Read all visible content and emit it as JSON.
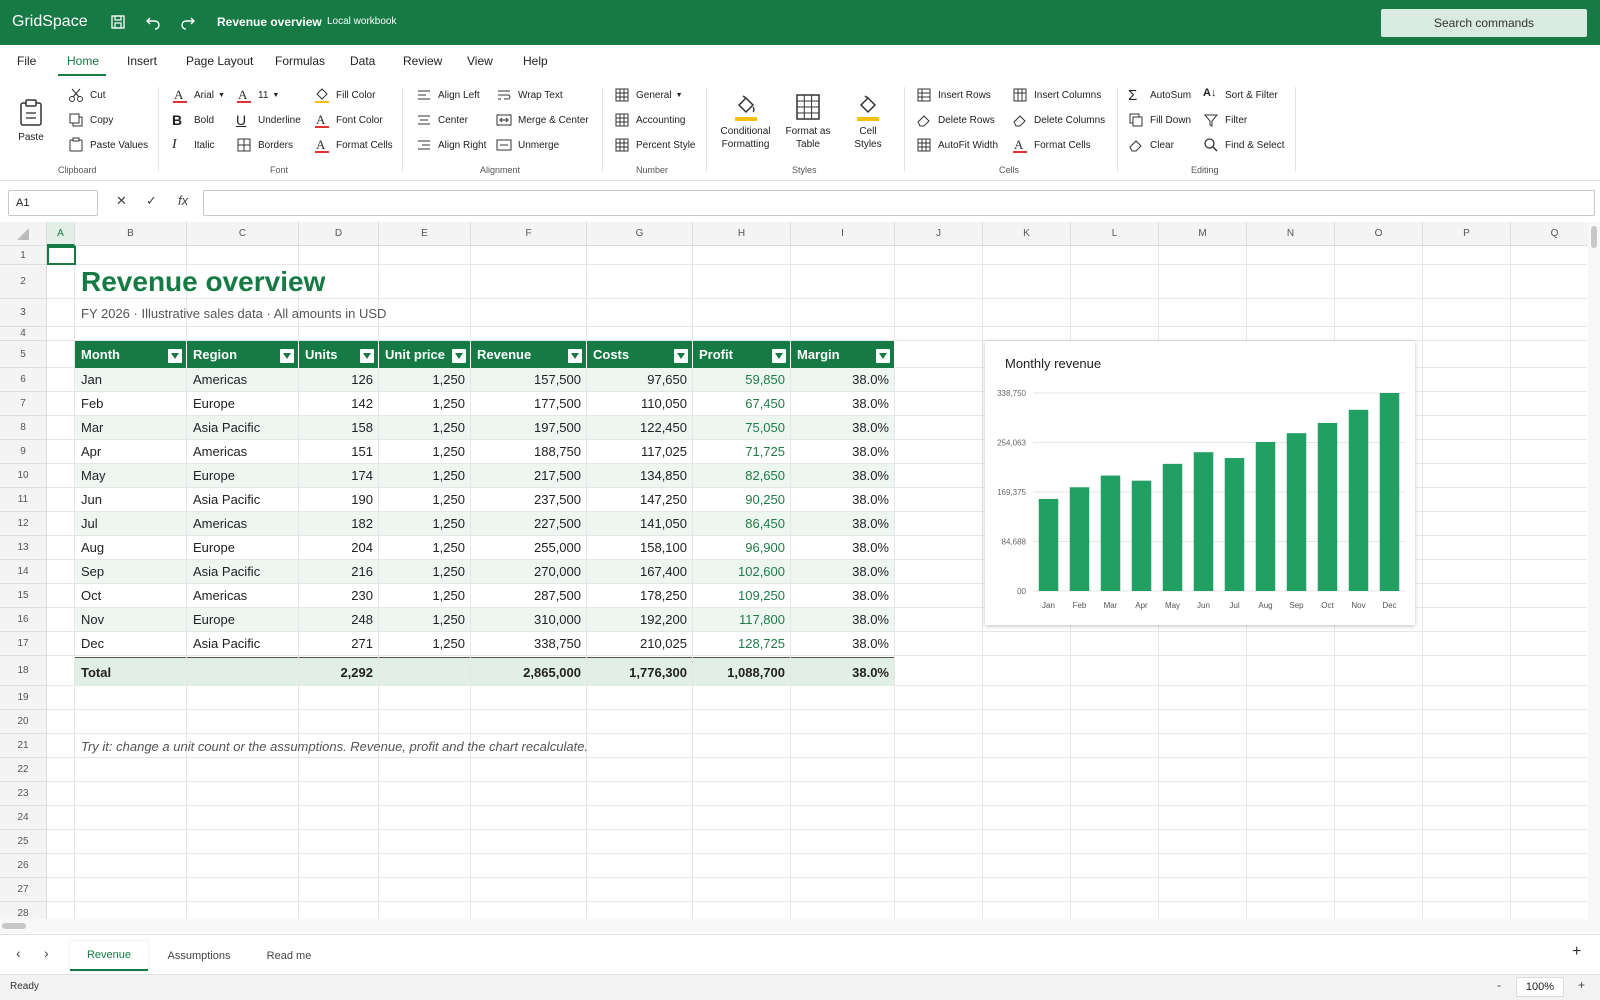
{
  "app": {
    "name": "GridSpace",
    "workbook": "Revenue overview",
    "location": "Local workbook",
    "search_placeholder": "Search commands"
  },
  "colors": {
    "brand": "#157a43",
    "chart_bar": "#22a064",
    "profit_text": "#1e7d46",
    "band": "#eef6f1"
  },
  "menu_tabs": [
    "File",
    "Home",
    "Insert",
    "Page Layout",
    "Formulas",
    "Data",
    "Review",
    "View",
    "Help"
  ],
  "active_tab": "Home",
  "ribbon": {
    "clipboard": {
      "paste": "Paste",
      "cut": "Cut",
      "copy": "Copy",
      "paste_values": "Paste Values",
      "label": "Clipboard"
    },
    "font": {
      "font_name": "Arial",
      "font_size": "11",
      "bold": "Bold",
      "italic": "Italic",
      "underline": "Underline",
      "borders": "Borders",
      "fill_color": "Fill Color",
      "font_color": "Font Color",
      "format_cells": "Format Cells",
      "label": "Font"
    },
    "alignment": {
      "align_left": "Align Left",
      "center": "Center",
      "align_right": "Align Right",
      "wrap_text": "Wrap Text",
      "merge_center": "Merge & Center",
      "unmerge": "Unmerge",
      "label": "Alignment"
    },
    "number": {
      "format": "General",
      "accounting": "Accounting",
      "percent": "Percent Style",
      "label": "Number"
    },
    "styles": {
      "conditional_1": "Conditional",
      "conditional_2": "Formatting",
      "format_table_1": "Format as",
      "format_table_2": "Table",
      "cell_styles_1": "Cell",
      "cell_styles_2": "Styles",
      "label": "Styles"
    },
    "cells": {
      "insert_rows": "Insert Rows",
      "delete_rows": "Delete Rows",
      "autofit": "AutoFit Width",
      "insert_columns": "Insert Columns",
      "delete_columns": "Delete Columns",
      "format_cells": "Format Cells",
      "label": "Cells"
    },
    "editing": {
      "autosum": "AutoSum",
      "fill_down": "Fill Down",
      "clear": "Clear",
      "sort_filter": "Sort & Filter",
      "filter": "Filter",
      "find_select": "Find & Select",
      "label": "Editing"
    }
  },
  "formula_bar": {
    "name_box": "A1",
    "fx": "fx",
    "value": ""
  },
  "columns": [
    "A",
    "B",
    "C",
    "D",
    "E",
    "F",
    "G",
    "H",
    "I",
    "J",
    "K",
    "L",
    "M",
    "N",
    "O",
    "P",
    "Q"
  ],
  "rows": [
    "1",
    "2",
    "3",
    "4",
    "5",
    "6",
    "7",
    "8",
    "9",
    "10",
    "11",
    "12",
    "13",
    "14",
    "15",
    "16",
    "17",
    "18",
    "19",
    "20",
    "21",
    "22",
    "23",
    "24",
    "25",
    "26",
    "27",
    "28"
  ],
  "sheet": {
    "title": "Revenue overview",
    "subtitle": "FY 2026  ·  Illustrative sales data  ·  All amounts in USD",
    "headers": [
      "Month",
      "Region",
      "Units",
      "Unit price",
      "Revenue",
      "Costs",
      "Profit",
      "Margin"
    ],
    "data": [
      [
        "Jan",
        "Americas",
        "126",
        "1,250",
        "157,500",
        "97,650",
        "59,850",
        "38.0%"
      ],
      [
        "Feb",
        "Europe",
        "142",
        "1,250",
        "177,500",
        "110,050",
        "67,450",
        "38.0%"
      ],
      [
        "Mar",
        "Asia Pacific",
        "158",
        "1,250",
        "197,500",
        "122,450",
        "75,050",
        "38.0%"
      ],
      [
        "Apr",
        "Americas",
        "151",
        "1,250",
        "188,750",
        "117,025",
        "71,725",
        "38.0%"
      ],
      [
        "May",
        "Europe",
        "174",
        "1,250",
        "217,500",
        "134,850",
        "82,650",
        "38.0%"
      ],
      [
        "Jun",
        "Asia Pacific",
        "190",
        "1,250",
        "237,500",
        "147,250",
        "90,250",
        "38.0%"
      ],
      [
        "Jul",
        "Americas",
        "182",
        "1,250",
        "227,500",
        "141,050",
        "86,450",
        "38.0%"
      ],
      [
        "Aug",
        "Europe",
        "204",
        "1,250",
        "255,000",
        "158,100",
        "96,900",
        "38.0%"
      ],
      [
        "Sep",
        "Asia Pacific",
        "216",
        "1,250",
        "270,000",
        "167,400",
        "102,600",
        "38.0%"
      ],
      [
        "Oct",
        "Americas",
        "230",
        "1,250",
        "287,500",
        "178,250",
        "109,250",
        "38.0%"
      ],
      [
        "Nov",
        "Europe",
        "248",
        "1,250",
        "310,000",
        "192,200",
        "117,800",
        "38.0%"
      ],
      [
        "Dec",
        "Asia Pacific",
        "271",
        "1,250",
        "338,750",
        "210,025",
        "128,725",
        "38.0%"
      ]
    ],
    "total": [
      "Total",
      "",
      "2,292",
      "",
      "2,865,000",
      "1,776,300",
      "1,088,700",
      "38.0%"
    ],
    "hint": "Try it: change a unit count or the assumptions. Revenue, profit and the chart recalculate."
  },
  "chart_data": {
    "type": "bar",
    "title": "Monthly revenue",
    "categories": [
      "Jan",
      "Feb",
      "Mar",
      "Apr",
      "May",
      "Jun",
      "Jul",
      "Aug",
      "Sep",
      "Oct",
      "Nov",
      "Dec"
    ],
    "values": [
      157500,
      177500,
      197500,
      188750,
      217500,
      237500,
      227500,
      255000,
      270000,
      287500,
      310000,
      338750
    ],
    "ylim": [
      0,
      338750
    ],
    "yticks": [
      "00",
      "84,688",
      "169,375",
      "254,063",
      "338,750"
    ],
    "grid": true
  },
  "sheet_tabs": [
    "Revenue",
    "Assumptions",
    "Read me"
  ],
  "active_sheet": "Revenue",
  "status": {
    "text": "Ready",
    "zoom": "100%",
    "minus": "-",
    "plus": "+"
  }
}
